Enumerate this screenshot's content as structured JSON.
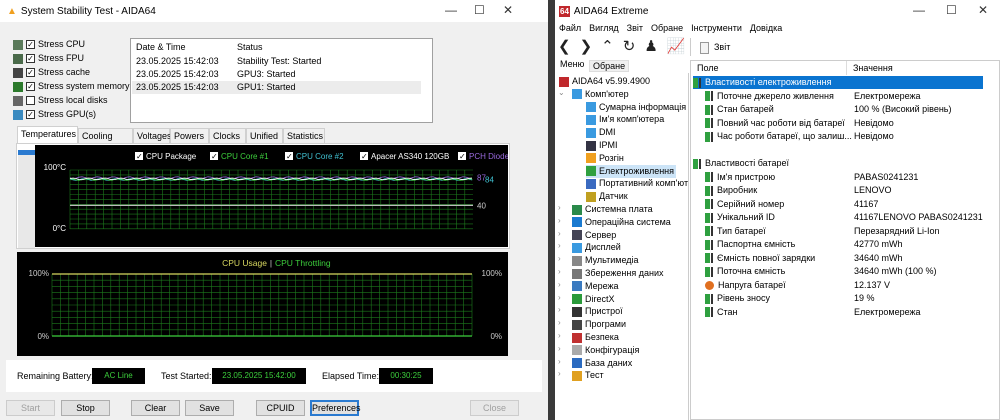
{
  "left": {
    "title": "System Stability Test - AIDA64",
    "stress": [
      {
        "label": "Stress CPU",
        "checked": true,
        "color": "#5a7a5a"
      },
      {
        "label": "Stress FPU",
        "checked": true,
        "color": "#4a6a4a"
      },
      {
        "label": "Stress cache",
        "checked": true,
        "color": "#444"
      },
      {
        "label": "Stress system memory",
        "checked": true,
        "color": "#2c7a2c"
      },
      {
        "label": "Stress local disks",
        "checked": false,
        "color": "#666"
      },
      {
        "label": "Stress GPU(s)",
        "checked": true,
        "color": "#3a8ac0"
      }
    ],
    "log": {
      "headers": [
        "Date & Time",
        "Status"
      ],
      "rows": [
        [
          "23.05.2025 15:42:03",
          "Stability Test: Started"
        ],
        [
          "23.05.2025 15:42:03",
          "GPU3: Started"
        ],
        [
          "23.05.2025 15:42:03",
          "GPU1: Started"
        ]
      ]
    },
    "tabs": [
      "Temperatures",
      "Cooling Fans",
      "Voltages",
      "Powers",
      "Clocks",
      "Unified",
      "Statistics"
    ],
    "temp_chart": {
      "legend": [
        {
          "label": "CPU Package",
          "color": "#ffffff"
        },
        {
          "label": "CPU Core #1",
          "color": "#3ccf3c"
        },
        {
          "label": "CPU Core #2",
          "color": "#40c0d0"
        },
        {
          "label": "Apacer AS340 120GB",
          "color": "#ffffff"
        },
        {
          "label": "PCH Diode",
          "color": "#9a6adf"
        }
      ],
      "y_top": "100°C",
      "y_bottom": "0°C",
      "ymin": 0,
      "ymax": 100,
      "readings": [
        {
          "value": "87",
          "color": "#9a6adf",
          "v": 87
        },
        {
          "value": "84",
          "color": "#40c0d0",
          "v": 84
        },
        {
          "value": "40",
          "color": "#cccccc",
          "v": 40
        }
      ]
    },
    "usage_chart": {
      "title_a": "CPU Usage",
      "sep": "|",
      "title_b": "CPU Throttling",
      "left_top": "100%",
      "left_bottom": "0%",
      "right_top": "100%",
      "right_bottom": "0%",
      "usage": 100,
      "throttling": 0
    },
    "status": {
      "battery_label": "Remaining Battery:",
      "battery": "AC Line",
      "started_label": "Test Started:",
      "started": "23.05.2025 15:42:00",
      "elapsed_label": "Elapsed Time:",
      "elapsed": "00:30:25"
    },
    "buttons": {
      "start": "Start",
      "stop": "Stop",
      "clear": "Clear",
      "save": "Save",
      "cpuid": "CPUID",
      "prefs": "Preferences",
      "close": "Close"
    }
  },
  "right": {
    "title": "AIDA64 Extreme",
    "menu": [
      "Файл",
      "Вигляд",
      "Звіт",
      "Обране",
      "Інструменти",
      "Довідка"
    ],
    "report": "Звіт",
    "tabs": [
      "Меню",
      "Обране"
    ],
    "tree": [
      {
        "label": "AIDA64 v5.99.4900",
        "lvl": 0,
        "icon": "aida64",
        "c": "#c0282c"
      },
      {
        "label": "Комп'ютер",
        "lvl": 1,
        "icon": "computer",
        "c": "#3a9ae0",
        "exp": "v"
      },
      {
        "label": "Сумарна інформація",
        "lvl": 2,
        "icon": "computer",
        "c": "#3a9ae0"
      },
      {
        "label": "Ім'я комп'ютера",
        "lvl": 2,
        "icon": "computer",
        "c": "#3a9ae0"
      },
      {
        "label": "DMI",
        "lvl": 2,
        "icon": "dmi",
        "c": "#3a9ae0"
      },
      {
        "label": "IPMI",
        "lvl": 2,
        "icon": "ipmi",
        "c": "#334"
      },
      {
        "label": "Розгін",
        "lvl": 2,
        "icon": "flame",
        "c": "#f0a020"
      },
      {
        "label": "Електроживлення",
        "lvl": 2,
        "icon": "battery",
        "c": "#2fa040",
        "sel": true
      },
      {
        "label": "Портативний комп'ют",
        "lvl": 2,
        "icon": "laptop",
        "c": "#3a6ac0"
      },
      {
        "label": "Датчик",
        "lvl": 2,
        "icon": "sensor",
        "c": "#c0a020"
      },
      {
        "label": "Системна плата",
        "lvl": 1,
        "icon": "motherboard",
        "c": "#2a8a4a",
        "exp": ">"
      },
      {
        "label": "Операційна система",
        "lvl": 1,
        "icon": "windows",
        "c": "#1a7ad0",
        "exp": ">"
      },
      {
        "label": "Сервер",
        "lvl": 1,
        "icon": "server",
        "c": "#445",
        "exp": ">"
      },
      {
        "label": "Дисплей",
        "lvl": 1,
        "icon": "display",
        "c": "#3a9ae0",
        "exp": ">"
      },
      {
        "label": "Мультимедіа",
        "lvl": 1,
        "icon": "speaker",
        "c": "#888",
        "exp": ">"
      },
      {
        "label": "Збереження даних",
        "lvl": 1,
        "icon": "storage",
        "c": "#777",
        "exp": ">"
      },
      {
        "label": "Мережа",
        "lvl": 1,
        "icon": "network",
        "c": "#3a7ac0",
        "exp": ">"
      },
      {
        "label": "DirectX",
        "lvl": 1,
        "icon": "xbox",
        "c": "#2a9a3a",
        "exp": ">"
      },
      {
        "label": "Пристрої",
        "lvl": 1,
        "icon": "devices",
        "c": "#333",
        "exp": ">"
      },
      {
        "label": "Програми",
        "lvl": 1,
        "icon": "programs",
        "c": "#444",
        "exp": ">"
      },
      {
        "label": "Безпека",
        "lvl": 1,
        "icon": "shield",
        "c": "#c03030",
        "exp": ">"
      },
      {
        "label": "Конфігурація",
        "lvl": 1,
        "icon": "config",
        "c": "#aaa",
        "exp": ">"
      },
      {
        "label": "База даних",
        "lvl": 1,
        "icon": "database",
        "c": "#2a6ac0",
        "exp": ">"
      },
      {
        "label": "Тест",
        "lvl": 1,
        "icon": "test",
        "c": "#e0a020",
        "exp": ">"
      }
    ],
    "columns": [
      "Поле",
      "Значення"
    ],
    "groups": [
      {
        "title": "Властивості електроживлення",
        "rows": [
          [
            "Поточне джерело живлення",
            "Електромережа"
          ],
          [
            "Стан батарей",
            "100 % (Високий рівень)"
          ],
          [
            "Повний час роботи від батареї",
            "Невідомо"
          ],
          [
            "Час роботи батареї, що залиш...",
            "Невідомо"
          ]
        ]
      },
      {
        "title": "Властивості батареї",
        "rows": [
          [
            "Ім'я пристрою",
            "PABAS0241231"
          ],
          [
            "Виробник",
            "LENOVO"
          ],
          [
            "Серійний номер",
            "41167"
          ],
          [
            "Унікальний ID",
            "41167LENOVO PABAS0241231"
          ],
          [
            "Тип батареї",
            "Перезарядний Li-Ion"
          ],
          [
            "Паспортна ємність",
            "42770 mWh"
          ],
          [
            "Ємність повної зарядки",
            "34640 mWh"
          ],
          [
            "Поточна ємність",
            "34640 mWh  (100 %)"
          ],
          [
            "Напруга батареї",
            "12.137 V"
          ],
          [
            "Рівень зносу",
            "19 %"
          ],
          [
            "Стан",
            "Електромережа"
          ]
        ]
      }
    ]
  }
}
